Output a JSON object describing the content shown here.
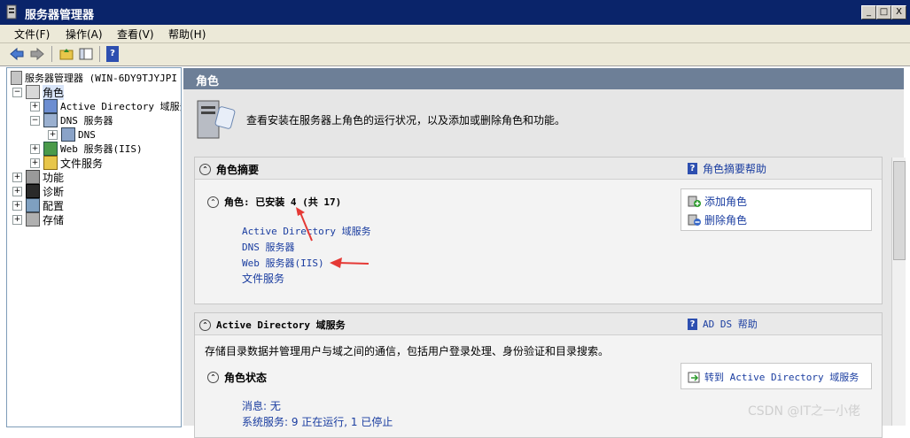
{
  "window": {
    "title": "服务器管理器",
    "minimize": "_",
    "restore": "□",
    "close": "X"
  },
  "menu": [
    "文件(F)",
    "操作(A)",
    "查看(V)",
    "帮助(H)"
  ],
  "tree": {
    "root": "服务器管理器 (WIN-6DY9TJYJPI",
    "roles": "角色",
    "ad": "Active Directory 域服务",
    "dns_server": "DNS 服务器",
    "dns": "DNS",
    "web": "Web 服务器(IIS)",
    "file": "文件服务",
    "features": "功能",
    "diagnostics": "诊断",
    "config": "配置",
    "storage": "存储"
  },
  "main": {
    "header": "角色",
    "intro": "查看安装在服务器上角色的运行状况，以及添加或删除角色和功能。",
    "summary": {
      "title": "角色摘要",
      "help": "角色摘要帮助",
      "roles_label": "角色: 已安装 4 (共 17)",
      "roles": [
        "Active Directory 域服务",
        "DNS 服务器",
        "Web 服务器(IIS)",
        "文件服务"
      ],
      "add_role": "添加角色",
      "remove_role": "删除角色"
    },
    "ad_section": {
      "title": "Active Directory 域服务",
      "help": "AD DS 帮助",
      "desc": "存储目录数据并管理用户与域之间的通信，包括用户登录处理、身份验证和目录搜索。",
      "status_title": "角色状态",
      "goto": "转到 Active Directory 域服务",
      "messages": "消息: 无",
      "services": "系统服务: 9 正在运行, 1 已停止"
    }
  },
  "watermark": "CSDN @IT之一小佬",
  "colors": {
    "titlebar": "#0a246a",
    "header": "#6d7f97",
    "link": "#1a3da0",
    "annotation": "#e53935"
  }
}
